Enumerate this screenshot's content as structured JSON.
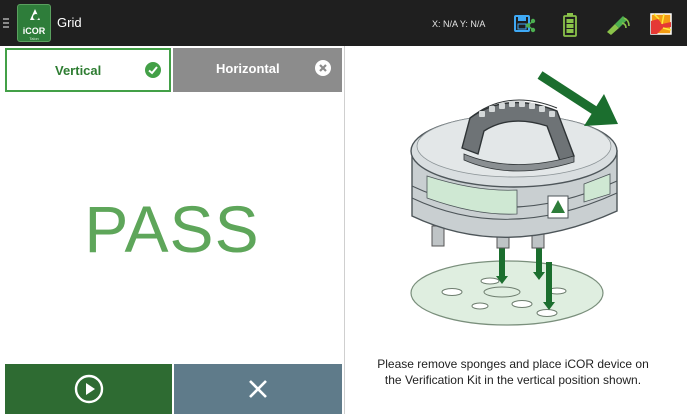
{
  "header": {
    "app_title": "Grid",
    "logo_text": "iCOR",
    "logo_subtext": "Talon",
    "coords_label": "X: N/A Y: N/A",
    "icons": [
      "menu-icon",
      "save-share-icon",
      "battery-icon",
      "signal-icon",
      "map-icon"
    ]
  },
  "tabs": [
    {
      "label": "Vertical",
      "state": "selected",
      "icon": "check-circle-icon"
    },
    {
      "label": "Horizontal",
      "state": "unselected",
      "icon": "close-circle-icon"
    }
  ],
  "result": {
    "text": "PASS"
  },
  "buttons": [
    {
      "name": "play",
      "icon": "play-circle-icon"
    },
    {
      "name": "cancel",
      "icon": "close-icon"
    }
  ],
  "instruction": {
    "line1": "Please remove sponges and place iCOR device on",
    "line2": "the Verification Kit in the vertical position shown."
  },
  "colors": {
    "topbar": "#1f1f1f",
    "accent_green": "#43a047",
    "pass_green": "#5ea65a",
    "play_button": "#2e6b32",
    "cancel_button": "#5f7b8a",
    "tab_inactive": "#8c8c8c",
    "arrow_green": "#1b6e2e"
  }
}
